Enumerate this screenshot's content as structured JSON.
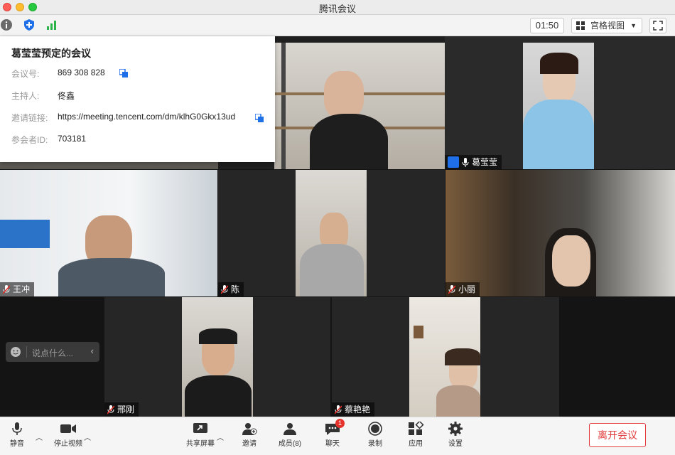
{
  "window": {
    "title": "腾讯会议"
  },
  "toolbar": {
    "timer": "01:50",
    "view_mode": "宫格视图"
  },
  "meeting_info": {
    "title": "葛莹莹预定的会议",
    "rows": [
      {
        "label": "会议号:",
        "value": "869 308 828"
      },
      {
        "label": "主持人:",
        "value": "佟鑫"
      },
      {
        "label": "邀请链接:",
        "value": "https://meeting.tencent.com/dm/klhG0Gkx13ud"
      },
      {
        "label": "参会者ID:",
        "value": "703181"
      }
    ]
  },
  "participants": [
    {
      "name": "葛莹莹",
      "muted": false
    },
    {
      "name": "王冲",
      "muted": true
    },
    {
      "name": "陈",
      "muted": true
    },
    {
      "name": "小丽",
      "muted": true
    },
    {
      "name": "邢刚",
      "muted": true
    },
    {
      "name": "蔡艳艳",
      "muted": true
    }
  ],
  "chat": {
    "placeholder": "说点什么..."
  },
  "controls": {
    "mute": "静音",
    "stop_video": "停止视频",
    "share_screen": "共享屏幕",
    "invite": "邀请",
    "members": "成员(8)",
    "chat": "聊天",
    "chat_badge": "1",
    "record": "录制",
    "apps": "应用",
    "settings": "设置",
    "leave": "离开会议"
  }
}
